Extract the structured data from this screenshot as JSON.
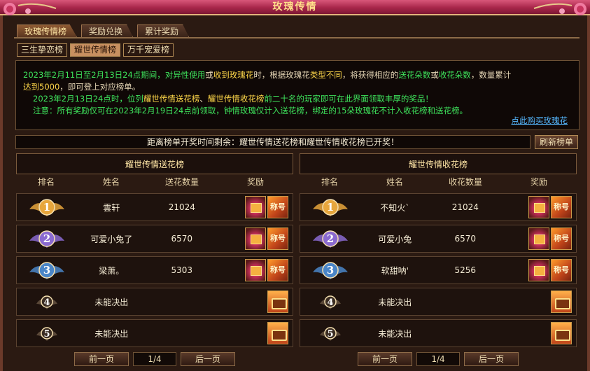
{
  "window": {
    "title": "玫瑰传情"
  },
  "main_tabs": [
    {
      "label": "玫瑰传情榜",
      "active": true
    },
    {
      "label": "奖励兑换",
      "active": false
    },
    {
      "label": "累计奖励",
      "active": false
    }
  ],
  "sub_tabs": [
    {
      "label": "三生挚恋榜",
      "active": false
    },
    {
      "label": "耀世传情榜",
      "active": true
    },
    {
      "label": "万千宠爱榜",
      "active": false
    }
  ],
  "notice": {
    "l1a": "2023年2月11日至2月13日24点期间，",
    "l1b": "对异性使用",
    "l1c": "或",
    "l1d": "收到玫瑰花",
    "l1e": "时，根据玫瑰花",
    "l1f": "类型不同",
    "l1g": "，将获得相应的",
    "l1h": "送花朵数",
    "l1i": "或",
    "l1j": "收花朵数",
    "l1k": "，数量累计",
    "l2a": "达到5000",
    "l2b": "，即可登上对应榜单。",
    "l3a": "2023年2月13日24点时，位列",
    "l3b": "耀世传情送花榜",
    "l3c": "、",
    "l3d": "耀世传情收花榜",
    "l3e": "前二十名的玩家即可在此界面领取丰厚的奖品！",
    "l4a": "注意：所有奖励仅可在2023年2月19日24点前领取，钟情玫瑰仅计入送花榜，绑定的15朵玫瑰花不计入收花榜和送花榜。",
    "buy_link": "点此购买玫瑰花"
  },
  "countdown_text": "距离榜单开奖时间剩余：耀世传情送花榜和耀世传情收花榜已开奖！",
  "refresh_label": "刷新榜单",
  "send_board": {
    "title": "耀世传情送花榜",
    "headers": {
      "rank": "排名",
      "name": "姓名",
      "count": "送花数量",
      "reward": "奖励"
    },
    "rows": [
      {
        "rank": "1",
        "name": "雲轩",
        "count": "21024"
      },
      {
        "rank": "2",
        "name": "可爱小兔了",
        "count": "6570"
      },
      {
        "rank": "3",
        "name": "梁萧。",
        "count": "5303"
      },
      {
        "rank": "4",
        "name": "未能决出",
        "count": ""
      },
      {
        "rank": "5",
        "name": "未能决出",
        "count": ""
      }
    ],
    "pager": {
      "prev": "前一页",
      "page": "1/4",
      "next": "后一页"
    }
  },
  "recv_board": {
    "title": "耀世传情收花榜",
    "headers": {
      "rank": "排名",
      "name": "姓名",
      "count": "收花数量",
      "reward": "奖励"
    },
    "rows": [
      {
        "rank": "1",
        "name": "不知火`",
        "count": "21024"
      },
      {
        "rank": "2",
        "name": "可爱小兔",
        "count": "6570"
      },
      {
        "rank": "3",
        "name": "软甜呐'",
        "count": "5256"
      },
      {
        "rank": "4",
        "name": "未能决出",
        "count": ""
      },
      {
        "rank": "5",
        "name": "未能决出",
        "count": ""
      }
    ],
    "pager": {
      "prev": "前一页",
      "page": "1/4",
      "next": "后一页"
    }
  },
  "reward_book_text": "称号",
  "colors": {
    "gold": "#e7a63c",
    "silver": "#8a6ad0",
    "bronze": "#4a86c8",
    "plain": "#4a3a2c"
  },
  "icons": [
    "rose-icon",
    "gift-box-icon",
    "title-book-icon",
    "treasure-chest-icon",
    "rank-badge-icon"
  ]
}
